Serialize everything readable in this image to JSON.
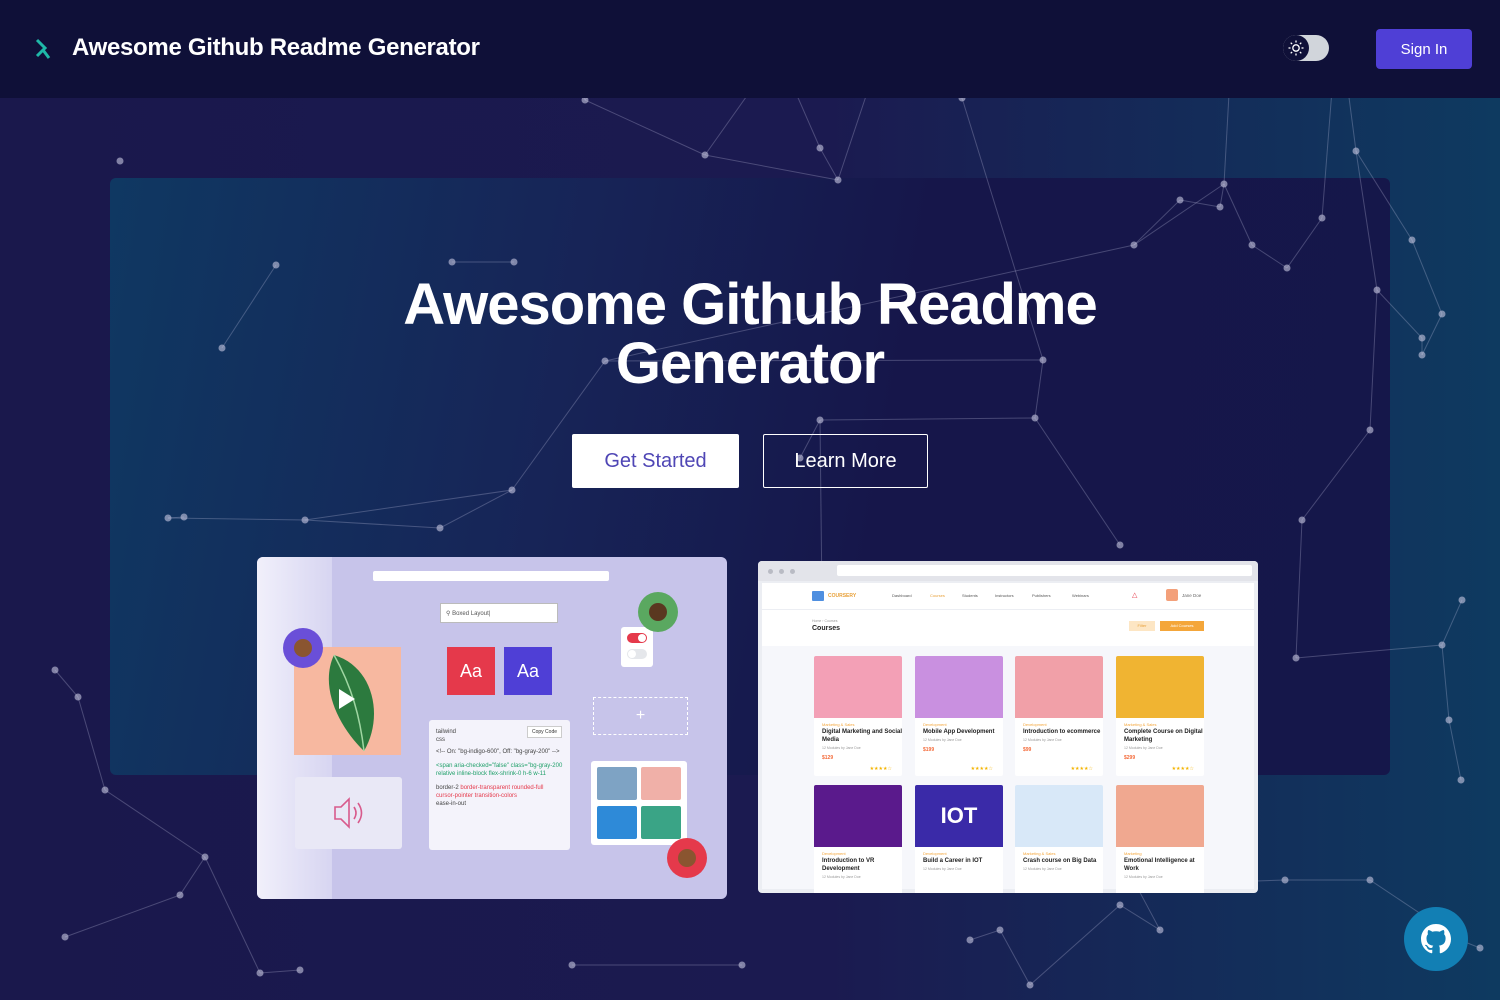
{
  "header": {
    "brand": "Awesome Github Readme Generator",
    "sign_in": "Sign In",
    "theme_toggle_icon": "sun-icon"
  },
  "hero": {
    "title_line1": "Awesome Github Readme",
    "title_line2": "Generator",
    "get_started": "Get Started",
    "learn_more": "Learn More"
  },
  "preview_left": {
    "search_placeholder": "Boxed Layout|",
    "aa1": "Aa",
    "aa2": "Aa",
    "code_lang1": "tailwind",
    "code_lang2": "css",
    "copy_code": "Copy Code",
    "code_comment": "<!-- On: \"bg-indigo-600\", Off: \"bg-gray-200\" -->",
    "code_green": "<span aria-checked=\"false\" class=\"bg-gray-200 relative inline-block flex-shrink-0 h-6 w-11",
    "code_tail": "border-2 ",
    "code_red": "border-transparent rounded-full cursor-pointer transition-colors",
    "code_end": "ease-in-out",
    "plus": "+"
  },
  "preview_right": {
    "logo": "COURSERY",
    "nav": [
      "Dashboard",
      "Courses",
      "Students",
      "Instructors",
      "Publishers",
      "Webinars"
    ],
    "user": "Jane Doe",
    "breadcrumb": "Home › Courses",
    "heading": "Courses",
    "btn_filter": "Filter",
    "btn_add": "Add Courses",
    "cards": [
      {
        "cat": "Marketing & Sales",
        "title": "Digital Marketing and Social Media",
        "meta": "12 Modules by Jane Doe",
        "price": "$129",
        "stars": "★★★★☆",
        "color": "#f3a0b6"
      },
      {
        "cat": "Development",
        "title": "Mobile App Development",
        "meta": "12 Modules by Jane Doe",
        "price": "$199",
        "stars": "★★★★☆",
        "color": "#c990e0"
      },
      {
        "cat": "Development",
        "title": "Introduction to ecommerce",
        "meta": "12 Modules by Jane Doe",
        "price": "$99",
        "stars": "★★★★☆",
        "color": "#f1a0a8"
      },
      {
        "cat": "Marketing & Sales",
        "title": "Complete Course on Digital Marketing",
        "meta": "12 Modules by Jane Doe",
        "price": "$299",
        "stars": "★★★★☆",
        "color": "#f0b432"
      },
      {
        "cat": "Development",
        "title": "Introduction to VR Development",
        "meta": "12 Modules by Jane Doe",
        "price": "",
        "stars": "",
        "color": "#5a1a8c"
      },
      {
        "cat": "Development",
        "title": "Build a Career in IOT",
        "meta": "12 Modules by Jane Doe",
        "price": "",
        "stars": "",
        "color": "#3a2aa8"
      },
      {
        "cat": "Marketing & Sales",
        "title": "Crash course on Big Data",
        "meta": "12 Modules by Jane Doe",
        "price": "",
        "stars": "",
        "color": "#d8e8f8"
      },
      {
        "cat": "Marketing",
        "title": "Emotional Intelligence at Work",
        "meta": "12 Modules by Jane Doe",
        "price": "",
        "stars": "",
        "color": "#f0a890"
      }
    ],
    "card_img_text": [
      "",
      "",
      "",
      "",
      "",
      "IOT",
      "",
      ""
    ]
  },
  "colors": {
    "topbar": "#0f1038",
    "background": "#1b1a4d",
    "accent": "#4f3fd6",
    "github_button": "#127fb4"
  },
  "icons": {
    "logo": "logo-icon",
    "github": "github-icon",
    "sun": "sun-icon"
  }
}
